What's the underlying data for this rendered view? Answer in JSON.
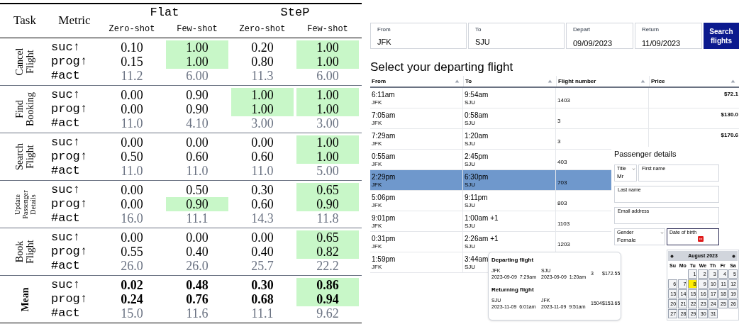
{
  "results_table": {
    "headers": {
      "task": "Task",
      "metric": "Metric"
    },
    "method_groups": [
      {
        "name": "Flat",
        "settings": [
          "Zero-shot",
          "Few-shot"
        ]
      },
      {
        "name": "SteP",
        "settings": [
          "Zero-shot",
          "Few-shot"
        ]
      }
    ],
    "tasks": [
      {
        "label_lines": [
          "Cancel",
          "Flight"
        ],
        "bold": false,
        "rows": [
          {
            "metric": "suc↑",
            "kind": "score",
            "cells": [
              {
                "value": "0.10",
                "highlighted": false
              },
              {
                "value": "1.00",
                "highlighted": true
              },
              {
                "value": "0.20",
                "highlighted": false
              },
              {
                "value": "1.00",
                "highlighted": true
              }
            ]
          },
          {
            "metric": "prog↑",
            "kind": "score",
            "cells": [
              {
                "value": "0.15",
                "highlighted": false
              },
              {
                "value": "1.00",
                "highlighted": true
              },
              {
                "value": "0.80",
                "highlighted": false
              },
              {
                "value": "1.00",
                "highlighted": true
              }
            ]
          },
          {
            "metric": "#act",
            "kind": "count",
            "cells": [
              {
                "value": "11.2",
                "highlighted": false
              },
              {
                "value": "6.00",
                "highlighted": false
              },
              {
                "value": "11.3",
                "highlighted": false
              },
              {
                "value": "6.00",
                "highlighted": false
              }
            ]
          }
        ]
      },
      {
        "label_lines": [
          "Find",
          "Booking"
        ],
        "bold": false,
        "rows": [
          {
            "metric": "suc↑",
            "kind": "score",
            "cells": [
              {
                "value": "0.00",
                "highlighted": false
              },
              {
                "value": "0.90",
                "highlighted": false
              },
              {
                "value": "1.00",
                "highlighted": true
              },
              {
                "value": "1.00",
                "highlighted": true
              }
            ]
          },
          {
            "metric": "prog↑",
            "kind": "score",
            "cells": [
              {
                "value": "0.00",
                "highlighted": false
              },
              {
                "value": "0.90",
                "highlighted": false
              },
              {
                "value": "1.00",
                "highlighted": true
              },
              {
                "value": "1.00",
                "highlighted": true
              }
            ]
          },
          {
            "metric": "#act",
            "kind": "count",
            "cells": [
              {
                "value": "11.0",
                "highlighted": false
              },
              {
                "value": "4.10",
                "highlighted": false
              },
              {
                "value": "3.00",
                "highlighted": false
              },
              {
                "value": "3.00",
                "highlighted": false
              }
            ]
          }
        ]
      },
      {
        "label_lines": [
          "Search",
          "Flight"
        ],
        "bold": false,
        "rows": [
          {
            "metric": "suc↑",
            "kind": "score",
            "cells": [
              {
                "value": "0.00",
                "highlighted": false
              },
              {
                "value": "0.00",
                "highlighted": false
              },
              {
                "value": "0.00",
                "highlighted": false
              },
              {
                "value": "1.00",
                "highlighted": true
              }
            ]
          },
          {
            "metric": "prog↑",
            "kind": "score",
            "cells": [
              {
                "value": "0.50",
                "highlighted": false
              },
              {
                "value": "0.60",
                "highlighted": false
              },
              {
                "value": "0.60",
                "highlighted": false
              },
              {
                "value": "1.00",
                "highlighted": true
              }
            ]
          },
          {
            "metric": "#act",
            "kind": "count",
            "cells": [
              {
                "value": "11.0",
                "highlighted": false
              },
              {
                "value": "11.0",
                "highlighted": false
              },
              {
                "value": "11.0",
                "highlighted": false
              },
              {
                "value": "5.00",
                "highlighted": false
              }
            ]
          }
        ]
      },
      {
        "label_lines": [
          "Update",
          "Passenger",
          "Details"
        ],
        "bold": false,
        "rows": [
          {
            "metric": "suc↑",
            "kind": "score",
            "cells": [
              {
                "value": "0.00",
                "highlighted": false
              },
              {
                "value": "0.50",
                "highlighted": false
              },
              {
                "value": "0.30",
                "highlighted": false
              },
              {
                "value": "0.65",
                "highlighted": true
              }
            ]
          },
          {
            "metric": "prog↑",
            "kind": "score",
            "cells": [
              {
                "value": "0.00",
                "highlighted": false
              },
              {
                "value": "0.90",
                "highlighted": true
              },
              {
                "value": "0.60",
                "highlighted": false
              },
              {
                "value": "0.90",
                "highlighted": true
              }
            ]
          },
          {
            "metric": "#act",
            "kind": "count",
            "cells": [
              {
                "value": "16.0",
                "highlighted": false
              },
              {
                "value": "11.1",
                "highlighted": false
              },
              {
                "value": "14.3",
                "highlighted": false
              },
              {
                "value": "11.8",
                "highlighted": false
              }
            ]
          }
        ]
      },
      {
        "label_lines": [
          "Book",
          "Flight"
        ],
        "bold": false,
        "rows": [
          {
            "metric": "suc↑",
            "kind": "score",
            "cells": [
              {
                "value": "0.00",
                "highlighted": false
              },
              {
                "value": "0.00",
                "highlighted": false
              },
              {
                "value": "0.00",
                "highlighted": false
              },
              {
                "value": "0.65",
                "highlighted": true
              }
            ]
          },
          {
            "metric": "prog↑",
            "kind": "score",
            "cells": [
              {
                "value": "0.55",
                "highlighted": false
              },
              {
                "value": "0.40",
                "highlighted": false
              },
              {
                "value": "0.40",
                "highlighted": false
              },
              {
                "value": "0.82",
                "highlighted": true
              }
            ]
          },
          {
            "metric": "#act",
            "kind": "count",
            "cells": [
              {
                "value": "26.0",
                "highlighted": false
              },
              {
                "value": "26.0",
                "highlighted": false
              },
              {
                "value": "25.7",
                "highlighted": false
              },
              {
                "value": "22.2",
                "highlighted": false
              }
            ]
          }
        ]
      },
      {
        "label_lines": [
          "Mean"
        ],
        "bold": true,
        "rows": [
          {
            "metric": "suc↑",
            "kind": "score",
            "cells": [
              {
                "value": "0.02",
                "highlighted": false
              },
              {
                "value": "0.48",
                "highlighted": false
              },
              {
                "value": "0.30",
                "highlighted": false
              },
              {
                "value": "0.86",
                "highlighted": true
              }
            ]
          },
          {
            "metric": "prog↑",
            "kind": "score",
            "cells": [
              {
                "value": "0.24",
                "highlighted": false
              },
              {
                "value": "0.76",
                "highlighted": false
              },
              {
                "value": "0.68",
                "highlighted": false
              },
              {
                "value": "0.94",
                "highlighted": true
              }
            ]
          },
          {
            "metric": "#act",
            "kind": "count",
            "cells": [
              {
                "value": "15.0",
                "highlighted": false
              },
              {
                "value": "11.6",
                "highlighted": false
              },
              {
                "value": "11.1",
                "highlighted": false
              },
              {
                "value": "9.62",
                "highlighted": false
              }
            ]
          }
        ]
      }
    ]
  },
  "booking_page": {
    "search_form": {
      "fields": [
        {
          "label": "From",
          "value": "JFK"
        },
        {
          "label": "To",
          "value": "SJU"
        },
        {
          "label": "Depart",
          "value": "09/09/2023"
        },
        {
          "label": "Return",
          "value": "11/09/2023"
        }
      ],
      "button": "Search flights"
    },
    "heading": "Select your departing flight",
    "flights_table": {
      "columns": [
        "From",
        "To",
        "Flight number",
        "Price"
      ],
      "rows": [
        {
          "from_time": "6:11am",
          "from_code": "JFK",
          "to_time": "9:54am",
          "to_code": "SJU",
          "flight_number": "1403",
          "price": "$72.1",
          "selected": false
        },
        {
          "from_time": "7:05am",
          "from_code": "JFK",
          "to_time": "0:58am",
          "to_code": "SJU",
          "flight_number": "3",
          "price": "$130.0",
          "selected": false
        },
        {
          "from_time": "7:29am",
          "from_code": "JFK",
          "to_time": "1:20am",
          "to_code": "SJU",
          "flight_number": "3",
          "price": "$170.6",
          "selected": false
        },
        {
          "from_time": "0:55am",
          "from_code": "JFK",
          "to_time": "2:45pm",
          "to_code": "SJU",
          "flight_number": "403",
          "selected": false
        },
        {
          "from_time": "2:29pm",
          "from_code": "JFK",
          "to_time": "6:30pm",
          "to_code": "SJU",
          "flight_number": "703",
          "selected": true
        },
        {
          "from_time": "5:06pm",
          "from_code": "JFK",
          "to_time": "9:11pm",
          "to_code": "SJU",
          "flight_number": "803",
          "selected": false
        },
        {
          "from_time": "9:01pm",
          "from_code": "JFK",
          "to_time": "1:00am +1",
          "to_code": "SJU",
          "flight_number": "1103",
          "selected": false
        },
        {
          "from_time": "0:31pm",
          "from_code": "JFK",
          "to_time": "2:26am +1",
          "to_code": "SJU",
          "flight_number": "1203",
          "selected": false
        },
        {
          "from_time": "1:59pm",
          "from_code": "JFK",
          "to_time": "3:44am",
          "to_code": "SJU",
          "selected": false
        }
      ]
    },
    "trip_summary": {
      "sections": [
        {
          "title": "Departing flight",
          "from_code": "JFK",
          "from_datetime": "2023-09-09  7:29am",
          "to_code": "SJU",
          "to_datetime": "2023-09-09  1:20am",
          "flight_number": "3",
          "price": "$172.55"
        },
        {
          "title": "Returning flight",
          "from_code": "SJU",
          "from_datetime": "2023-11-09  6:01am",
          "to_code": "JFK",
          "to_datetime": "2023-11-09  9:51am",
          "flight_number": "1504",
          "price": "$153.65"
        }
      ]
    },
    "passenger_details": {
      "title": "Passenger details",
      "rows": [
        [
          {
            "kind": "select",
            "label": "Title",
            "value": "Mr"
          },
          {
            "kind": "text",
            "label": "First name"
          }
        ],
        [
          {
            "kind": "text",
            "label": "Last name"
          }
        ],
        [
          {
            "kind": "text",
            "label": "Email address"
          }
        ],
        [
          {
            "kind": "select",
            "label": "Gender",
            "value": "Female"
          },
          {
            "kind": "date",
            "label": "Date of birth"
          }
        ]
      ]
    },
    "date_picker": {
      "month": "August 2023",
      "weekdays": [
        "Su",
        "Mo",
        "Tu",
        "We",
        "Th",
        "Fr",
        "Sa"
      ],
      "weeks": [
        [
          {
            "day": "1",
            "selected": false
          },
          {
            "day": "2",
            "selected": false
          },
          {
            "day": "3",
            "selected": false
          },
          {
            "day": "4",
            "selected": false
          },
          {
            "day": "5",
            "selected": false
          }
        ],
        [
          {
            "day": "6",
            "selected": false
          },
          {
            "day": "7",
            "selected": false
          },
          {
            "day": "8",
            "selected": true
          },
          {
            "day": "9",
            "selected": false
          },
          {
            "day": "10",
            "selected": false
          },
          {
            "day": "11",
            "selected": false
          },
          {
            "day": "12",
            "selected": false
          }
        ],
        [
          {
            "day": "13",
            "selected": false
          },
          {
            "day": "14",
            "selected": false
          },
          {
            "day": "15",
            "selected": false
          },
          {
            "day": "16",
            "selected": false
          },
          {
            "day": "17",
            "selected": false
          },
          {
            "day": "18",
            "selected": false
          },
          {
            "day": "19",
            "selected": false
          }
        ],
        [
          {
            "day": "20",
            "selected": false
          },
          {
            "day": "21",
            "selected": false
          },
          {
            "day": "22",
            "selected": false
          },
          {
            "day": "23",
            "selected": false
          },
          {
            "day": "24",
            "selected": false
          },
          {
            "day": "25",
            "selected": false
          },
          {
            "day": "26",
            "selected": false
          }
        ],
        [
          {
            "day": "27",
            "selected": false
          },
          {
            "day": "28",
            "selected": false
          },
          {
            "day": "29",
            "selected": false
          },
          {
            "day": "30",
            "selected": false
          },
          {
            "day": "31",
            "selected": false
          }
        ]
      ]
    }
  }
}
